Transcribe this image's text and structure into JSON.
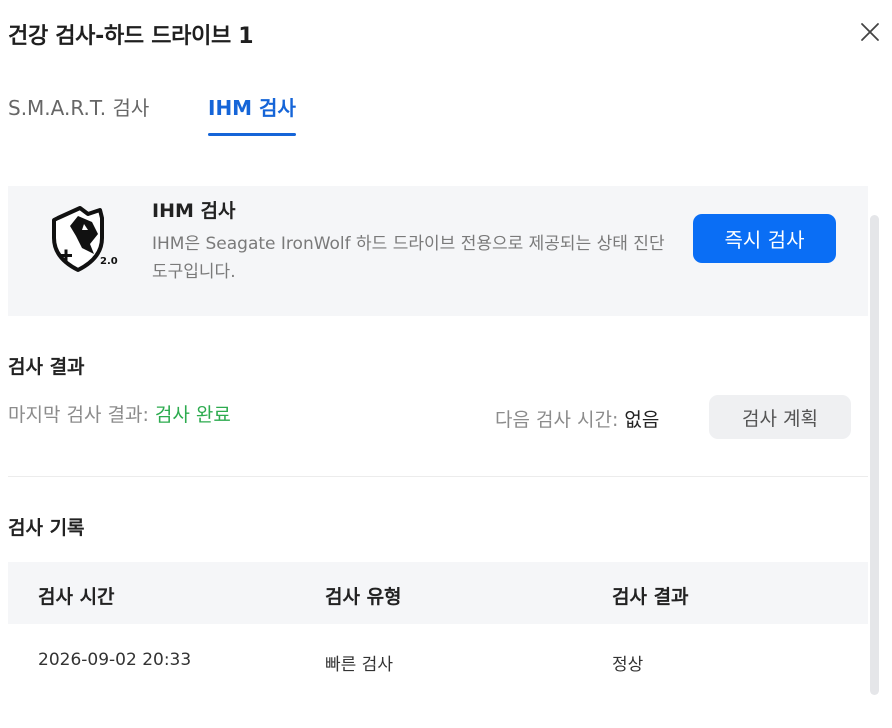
{
  "dialog": {
    "title": "건강 검사-하드 드라이브 1"
  },
  "tabs": [
    {
      "label": "S.M.A.R.T. 검사",
      "active": false
    },
    {
      "label": "IHM 검사",
      "active": true
    }
  ],
  "ihm_card": {
    "title": "IHM 검사",
    "description": "IHM은 Seagate IronWolf 하드 드라이브 전용으로 제공되는 상태 진단 도구입니다.",
    "run_button": "즉시 검사",
    "logo_version": "2.0"
  },
  "results": {
    "section_title": "검사 결과",
    "last_label": "마지막 검사 결과:",
    "last_value": "검사 완료",
    "next_label": "다음 검사 시간:",
    "next_value": "없음",
    "schedule_button": "검사 계획"
  },
  "history": {
    "section_title": "검사 기록",
    "columns": [
      "검사 시간",
      "검사 유형",
      "검사 결과"
    ],
    "rows": [
      [
        "2026-09-02 20:33",
        "빠른 검사",
        "정상"
      ]
    ]
  },
  "colors": {
    "accent": "#1565d8",
    "primary_button": "#0a6ef5",
    "success": "#2dab4f"
  },
  "icons": {
    "close": "close-icon",
    "logo": "ironwolf-shield-icon"
  }
}
